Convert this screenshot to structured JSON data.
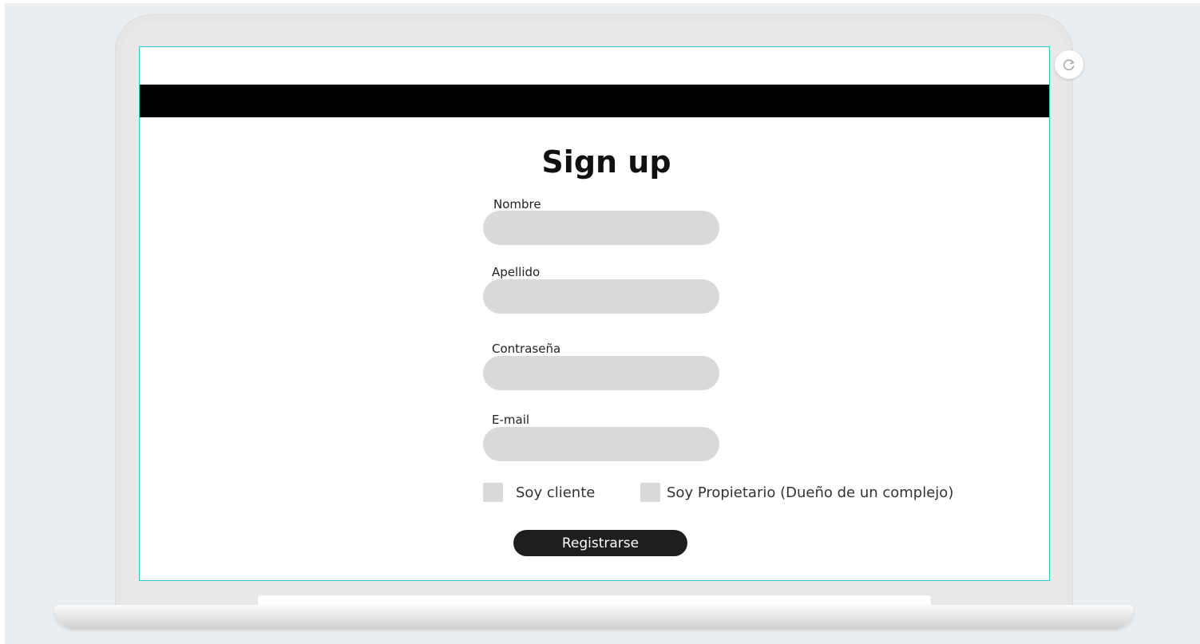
{
  "form": {
    "title": "Sign up",
    "fields": [
      {
        "label": "Nombre",
        "value": ""
      },
      {
        "label": "Apellido",
        "value": ""
      },
      {
        "label": "Contraseña",
        "value": ""
      },
      {
        "label": "E-mail",
        "value": ""
      }
    ],
    "checkboxes": [
      {
        "label": "Soy cliente",
        "checked": false
      },
      {
        "label": "Soy Propietario (Dueño de un complejo)",
        "checked": false
      }
    ],
    "submit_label": "Registrarse"
  },
  "icons": {
    "refresh": "refresh-icon"
  },
  "colors": {
    "header_bar": "#000000",
    "input_bg": "#d9d9d9",
    "button_bg": "#1e1e1e",
    "screen_border": "#35c2d0"
  }
}
